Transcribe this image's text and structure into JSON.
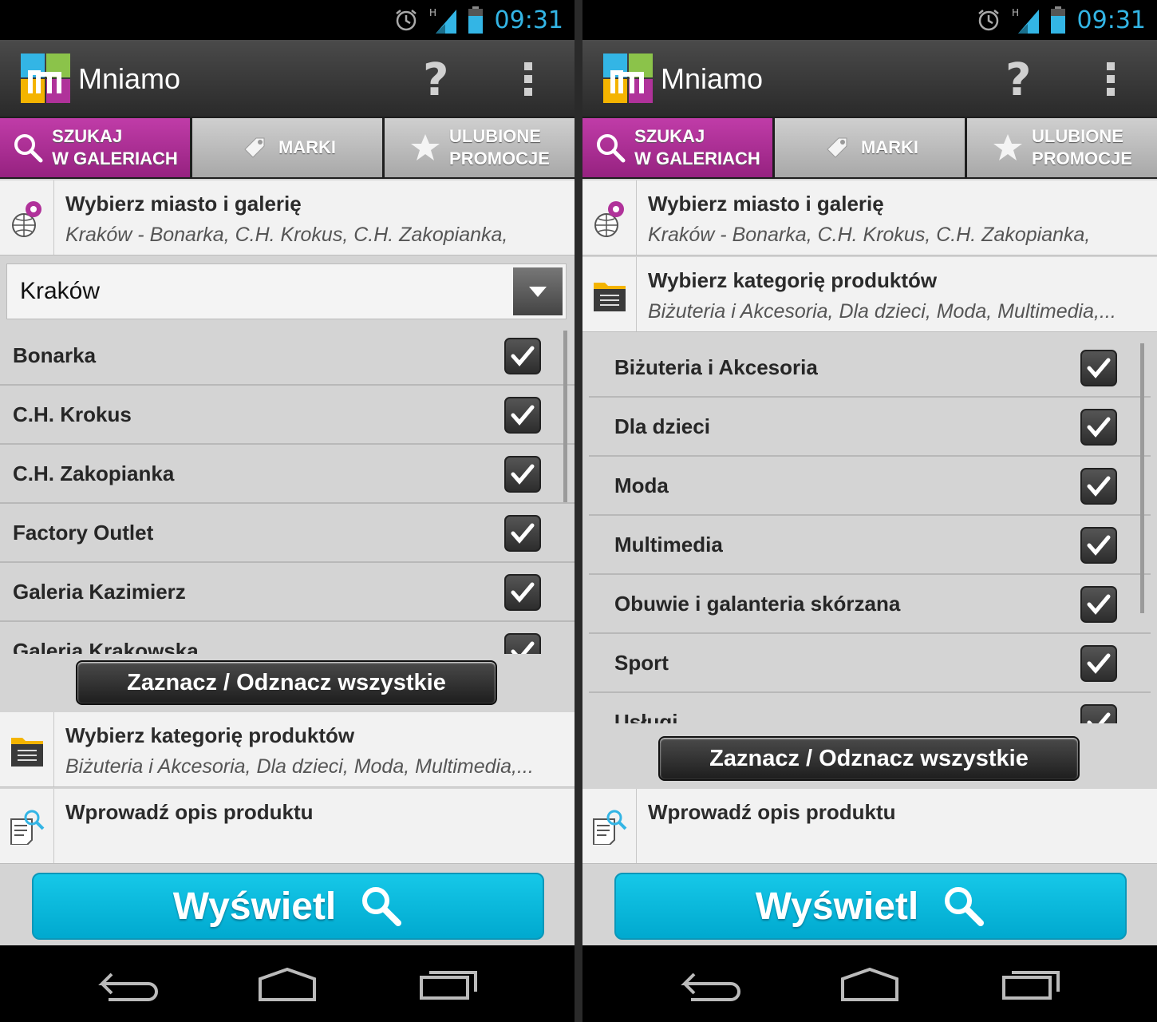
{
  "status": {
    "time": "09:31",
    "network": "H"
  },
  "app": {
    "title": "Mniamo"
  },
  "tabs": [
    {
      "line1": "SZUKAJ",
      "line2": "W GALERIACH"
    },
    {
      "label": "MARKI"
    },
    {
      "line1": "ULUBIONE",
      "line2": "PROMOCJE"
    }
  ],
  "city_section": {
    "title": "Wybierz miasto i galerię",
    "subtitle": "Kraków - Bonarka, C.H. Krokus, C.H. Zakopianka,"
  },
  "category_section": {
    "title": "Wybierz kategorię produktów",
    "subtitle": "Biżuteria i Akcesoria, Dla dzieci, Moda, Multimedia,..."
  },
  "description_section": {
    "title": "Wprowadź opis produktu"
  },
  "city_spinner": {
    "value": "Kraków"
  },
  "galleries": [
    "Bonarka",
    "C.H. Krokus",
    "C.H. Zakopianka",
    "Factory Outlet",
    "Galeria Kazimierz",
    "Galeria Krakowska"
  ],
  "categories": [
    "Biżuteria i Akcesoria",
    "Dla dzieci",
    "Moda",
    "Multimedia",
    "Obuwie i galanteria skórzana",
    "Sport",
    "Usługi"
  ],
  "toggle_all_label": "Zaznacz / Odznacz wszystkie",
  "show_button_label": "Wyświetl",
  "colors": {
    "accent": "#33b5e5",
    "tab_active": "#b0329a",
    "show_button": "#00bcd9"
  }
}
